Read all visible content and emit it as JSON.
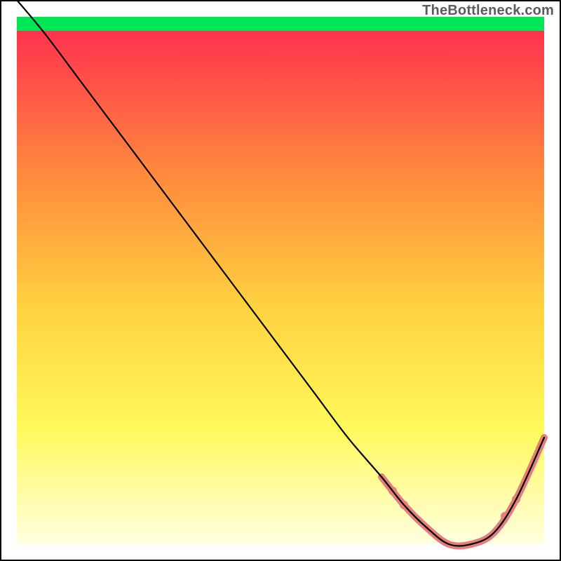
{
  "watermark": "TheBottleneck.com",
  "chart_data": {
    "type": "line",
    "title": "",
    "xlabel": "",
    "ylabel": "",
    "xlim": [
      0,
      100
    ],
    "ylim": [
      0,
      100
    ],
    "grid": false,
    "legend": false,
    "colors": {
      "gradient_top": "#ff2a4f",
      "gradient_mid1": "#ff8a3d",
      "gradient_mid2": "#ffd23f",
      "gradient_mid3": "#fff95b",
      "gradient_bottom": "#ffffe0",
      "band": "#00e756",
      "line": "#000000",
      "highlight": "#e47d7d"
    },
    "plot_margin": {
      "left": 3,
      "right": 3,
      "top": 3,
      "bottom": 3
    },
    "gradient_rect": {
      "x0": 3,
      "y0": 3,
      "x1": 97,
      "y1": 97
    },
    "green_band": {
      "y0": 94.5,
      "y1": 97
    },
    "series": [
      {
        "name": "bottleneck-curve",
        "x": [
          3,
          8,
          14,
          20,
          26,
          32,
          38,
          44,
          50,
          56,
          62,
          68,
          72,
          76,
          80,
          84,
          88,
          92,
          97
        ],
        "y": [
          100,
          94,
          86,
          78,
          70,
          62,
          54,
          46,
          38,
          30,
          22,
          15,
          10,
          6,
          3,
          3,
          5,
          11,
          22
        ]
      }
    ],
    "highlight_segment": {
      "from_x": 70,
      "to_x": 92,
      "note": "pink dotted highlight along curve trough"
    }
  }
}
